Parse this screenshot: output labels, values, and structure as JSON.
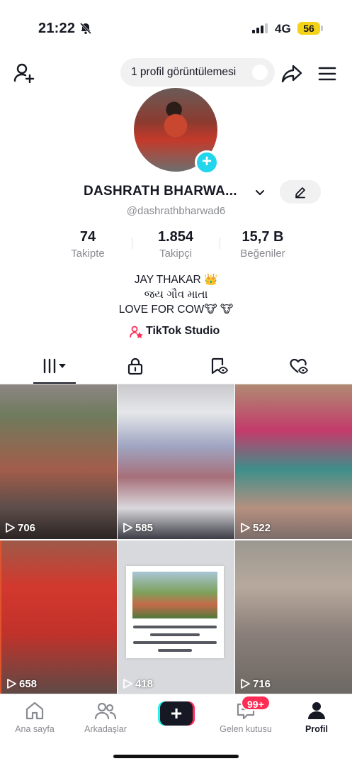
{
  "status_bar": {
    "time": "21:22",
    "network": "4G",
    "battery": "56"
  },
  "header": {
    "profile_views_label": "1 profil görüntülemesi"
  },
  "profile": {
    "display_name": "DASHRATH BHARWA...",
    "username": "@dashrathbharwad6",
    "stats": [
      {
        "value": "74",
        "label": "Takipte"
      },
      {
        "value": "1.854",
        "label": "Takipçi"
      },
      {
        "value": "15,7 B",
        "label": "Beğeniler"
      }
    ],
    "bio_lines": [
      "JAY THAKAR 👑",
      "જય ગૌવ માતા",
      "LOVE FOR COW🐮 🐮"
    ],
    "studio_link": "TikTok Studio"
  },
  "videos": [
    {
      "views": "706"
    },
    {
      "views": "585"
    },
    {
      "views": "522"
    },
    {
      "views": "658"
    },
    {
      "views": "418"
    },
    {
      "views": "716"
    }
  ],
  "bottom_nav": {
    "home": "Ana sayfa",
    "friends": "Arkadaşlar",
    "inbox": "Gelen kutusu",
    "inbox_badge": "99+",
    "profile": "Profil"
  },
  "colors": {
    "accent_cyan": "#20d5ec",
    "accent_red": "#fe2c55",
    "battery_yellow": "#f3d21a"
  }
}
